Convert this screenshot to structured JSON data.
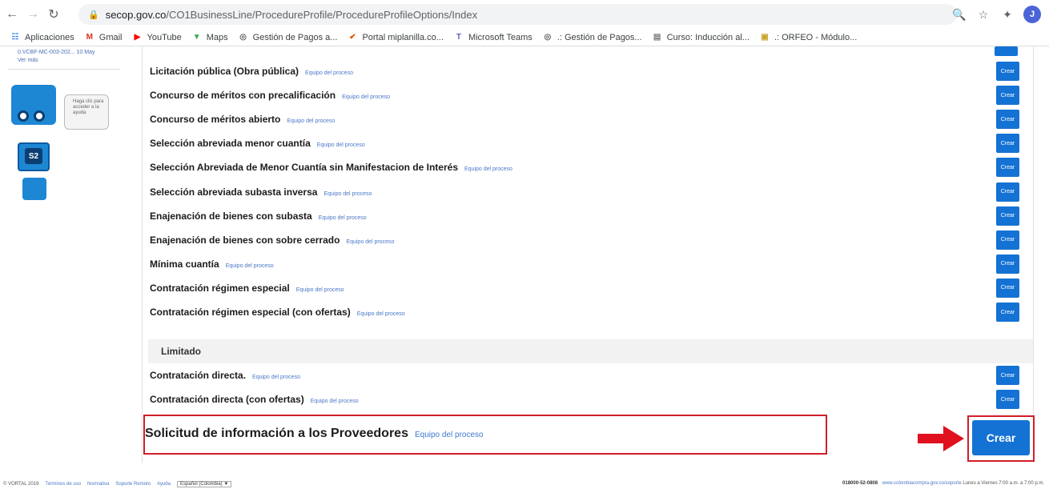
{
  "browser": {
    "url_domain": "secop.gov.co",
    "url_path": "/CO1BusinessLine/ProcedureProfile/ProcedureProfileOptions/Index",
    "profile_initial": "J"
  },
  "bookmarks": [
    {
      "label": "Aplicaciones",
      "icon": "apps-grid-icon",
      "color": "#4285f4"
    },
    {
      "label": "Gmail",
      "icon": "gmail-icon",
      "color": "#d93025"
    },
    {
      "label": "YouTube",
      "icon": "youtube-icon",
      "color": "#ff0000"
    },
    {
      "label": "Maps",
      "icon": "maps-pin-icon",
      "color": "#34a853"
    },
    {
      "label": "Gestión de Pagos a...",
      "icon": "globe-icon",
      "color": "#5f6368"
    },
    {
      "label": "Portal miplanilla.co...",
      "icon": "check-icon",
      "color": "#e65100"
    },
    {
      "label": "Microsoft Teams",
      "icon": "teams-icon",
      "color": "#5b5fc7"
    },
    {
      "label": ".: Gestión de Pagos...",
      "icon": "globe-icon",
      "color": "#5f6368"
    },
    {
      "label": "Curso: Inducción al...",
      "icon": "course-icon",
      "color": "#7a7a7a"
    },
    {
      "label": ".: ORFEO - Módulo...",
      "icon": "orfeo-icon",
      "color": "#c9a227"
    }
  ],
  "sidebar": {
    "top_link": "0.VCBF-MC-003-202... 10 May",
    "more_link": "Ver más",
    "bubble_text": "Haga clic para acceder a la ayuda",
    "bot_label": "S2"
  },
  "procedures": [
    {
      "title": "Licitación pública (Obra pública)",
      "link": "Equipo del proceso",
      "button": "Crear"
    },
    {
      "title": "Concurso de méritos con precalificación",
      "link": "Equipo del proceso",
      "button": "Crear"
    },
    {
      "title": "Concurso de méritos abierto",
      "link": "Equipo del proceso",
      "button": "Crear"
    },
    {
      "title": "Selección abreviada menor cuantía",
      "link": "Equipo del proceso",
      "button": "Crear"
    },
    {
      "title": "Selección Abreviada de Menor Cuantía sin Manifestacion de Interés",
      "link": "Equipo del proceso",
      "button": "Crear"
    },
    {
      "title": "Selección abreviada subasta inversa",
      "link": "Equipo del proceso",
      "button": "Crear"
    },
    {
      "title": "Enajenación de bienes con subasta",
      "link": "Equipo del proceso",
      "button": "Crear"
    },
    {
      "title": "Enajenación de bienes con sobre cerrado",
      "link": "Equipo del proceso",
      "button": "Crear"
    },
    {
      "title": "Mínima cuantía",
      "link": "Equipo del proceso",
      "button": "Crear"
    },
    {
      "title": "Contratación régimen especial",
      "link": "Equipo del proceso",
      "button": "Crear"
    },
    {
      "title": "Contratación régimen especial (con ofertas)",
      "link": "Equipo del proceso",
      "button": "Crear"
    }
  ],
  "limited_section": {
    "heading": "Limitado",
    "items": [
      {
        "title": "Contratación directa.",
        "link": "Equipo del proceso",
        "button": "Crear"
      },
      {
        "title": "Contratación directa (con ofertas)",
        "link": "Equipo del proceso",
        "button": "Crear"
      }
    ]
  },
  "highlighted": {
    "title": "Solicitud de información a los Proveedores",
    "link": "Equipo del proceso",
    "button": "Crear",
    "highlight_color": "#d11e2a"
  },
  "footer": {
    "copyright": "© VORTAL 2019",
    "links": [
      "Términos de uso",
      "Normativa",
      "Soporte Remoto",
      "Ayuda"
    ],
    "language": "Español (Colombia)",
    "phone": "018000-52-0808",
    "support_url": "www.colombiacompra.gov.co/soporte",
    "hours": "Lunes a Viernes 7:00 a.m. a 7:00 p.m."
  },
  "colors": {
    "primary_button": "#1472d4",
    "link": "#4a78c8"
  }
}
